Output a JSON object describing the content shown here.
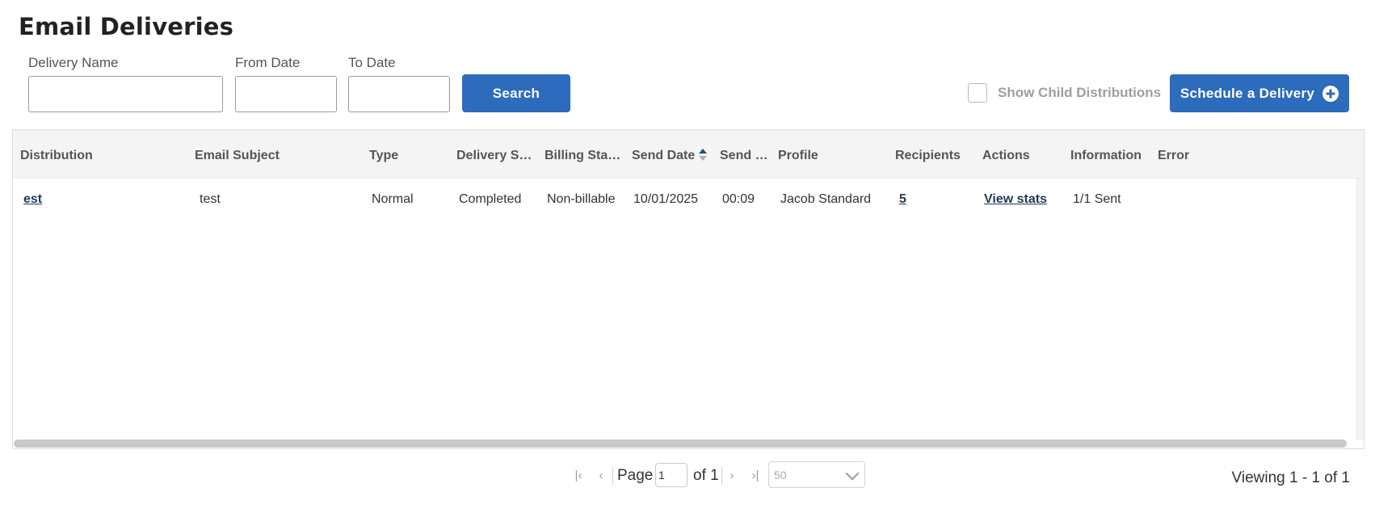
{
  "page": {
    "title": "Email Deliveries"
  },
  "filters": {
    "delivery_name": {
      "label": "Delivery Name",
      "value": "",
      "placeholder": ""
    },
    "from_date": {
      "label": "From Date",
      "value": "",
      "placeholder": ""
    },
    "to_date": {
      "label": "To Date",
      "value": "",
      "placeholder": ""
    },
    "search_label": "Search",
    "show_child_label": "Show Child Distributions",
    "show_child_checked": false,
    "schedule_label": "Schedule a Delivery",
    "schedule_icon": "plus-circle-icon"
  },
  "table": {
    "columns": [
      "Distribution",
      "Email Subject",
      "Type",
      "Delivery S…",
      "Billing Sta…",
      "Send Date",
      "Send …",
      "Profile",
      "Recipients",
      "Actions",
      "Information",
      "Error"
    ],
    "sorted_column": "Send Date",
    "sort_direction": "ascending",
    "rows": [
      {
        "distribution": "est",
        "email_subject": "test",
        "type": "Normal",
        "delivery_status": "Completed",
        "billing_status": "Non-billable",
        "send_date": "10/01/2025",
        "send_time": "00:09",
        "profile": "Jacob Standard",
        "recipients": "5",
        "actions": "View stats",
        "information": "1/1 Sent",
        "error": ""
      }
    ]
  },
  "pagination": {
    "page_label": "Page",
    "current_page": "1",
    "of_label": "of 1",
    "page_size": "50",
    "viewing": "Viewing 1 - 1 of 1",
    "colors": {
      "primary": "#2d6bbd",
      "link": "#1f3a56"
    }
  }
}
